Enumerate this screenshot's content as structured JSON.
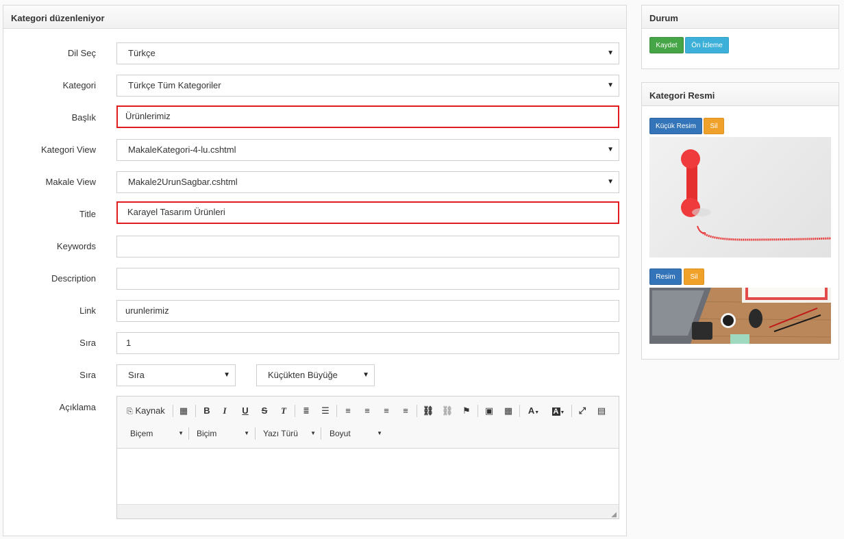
{
  "main": {
    "title": "Kategori düzenleniyor",
    "fields": {
      "dil": {
        "label": "Dil Seç",
        "value": "Türkçe"
      },
      "kategori": {
        "label": "Kategori",
        "value": "Türkçe Tüm Kategoriler"
      },
      "baslik": {
        "label": "Başlık",
        "value": "Ürünlerimiz"
      },
      "kategori_view": {
        "label": "Kategori View",
        "value": "MakaleKategori-4-lu.cshtml"
      },
      "makale_view": {
        "label": "Makale View",
        "value": "Makale2UrunSagbar.cshtml"
      },
      "title": {
        "label": "Title",
        "value": "Karayel Tasarım Ürünleri"
      },
      "keywords": {
        "label": "Keywords",
        "value": ""
      },
      "description": {
        "label": "Description",
        "value": ""
      },
      "link": {
        "label": "Link",
        "value": "urunlerimiz"
      },
      "sira": {
        "label": "Sıra",
        "value": "1"
      },
      "sira_order": {
        "label": "Sıra",
        "value": "Sıra",
        "direction": "Küçükten Büyüğe"
      },
      "aciklama": {
        "label": "Açıklama"
      }
    },
    "editor": {
      "source_label": "Kaynak",
      "combos": [
        "Biçem",
        "Biçim",
        "Yazı Türü",
        "Boyut"
      ],
      "bold": "B",
      "italic": "I",
      "underline": "U",
      "strike": "S",
      "clear": "T"
    }
  },
  "durum": {
    "title": "Durum",
    "save_label": "Kaydet",
    "preview_label": "Ön İzleme"
  },
  "resim": {
    "title": "Kategori Resmi",
    "small_image_label": "Küçük Resim",
    "delete_label": "Sil",
    "image_label": "Resim",
    "delete_label_2": "Sil"
  },
  "colors": {
    "highlight": "#e01b1b",
    "green": "#46a546",
    "cyan": "#3db0d9",
    "blue": "#3474b8",
    "orange": "#f0a12a"
  }
}
